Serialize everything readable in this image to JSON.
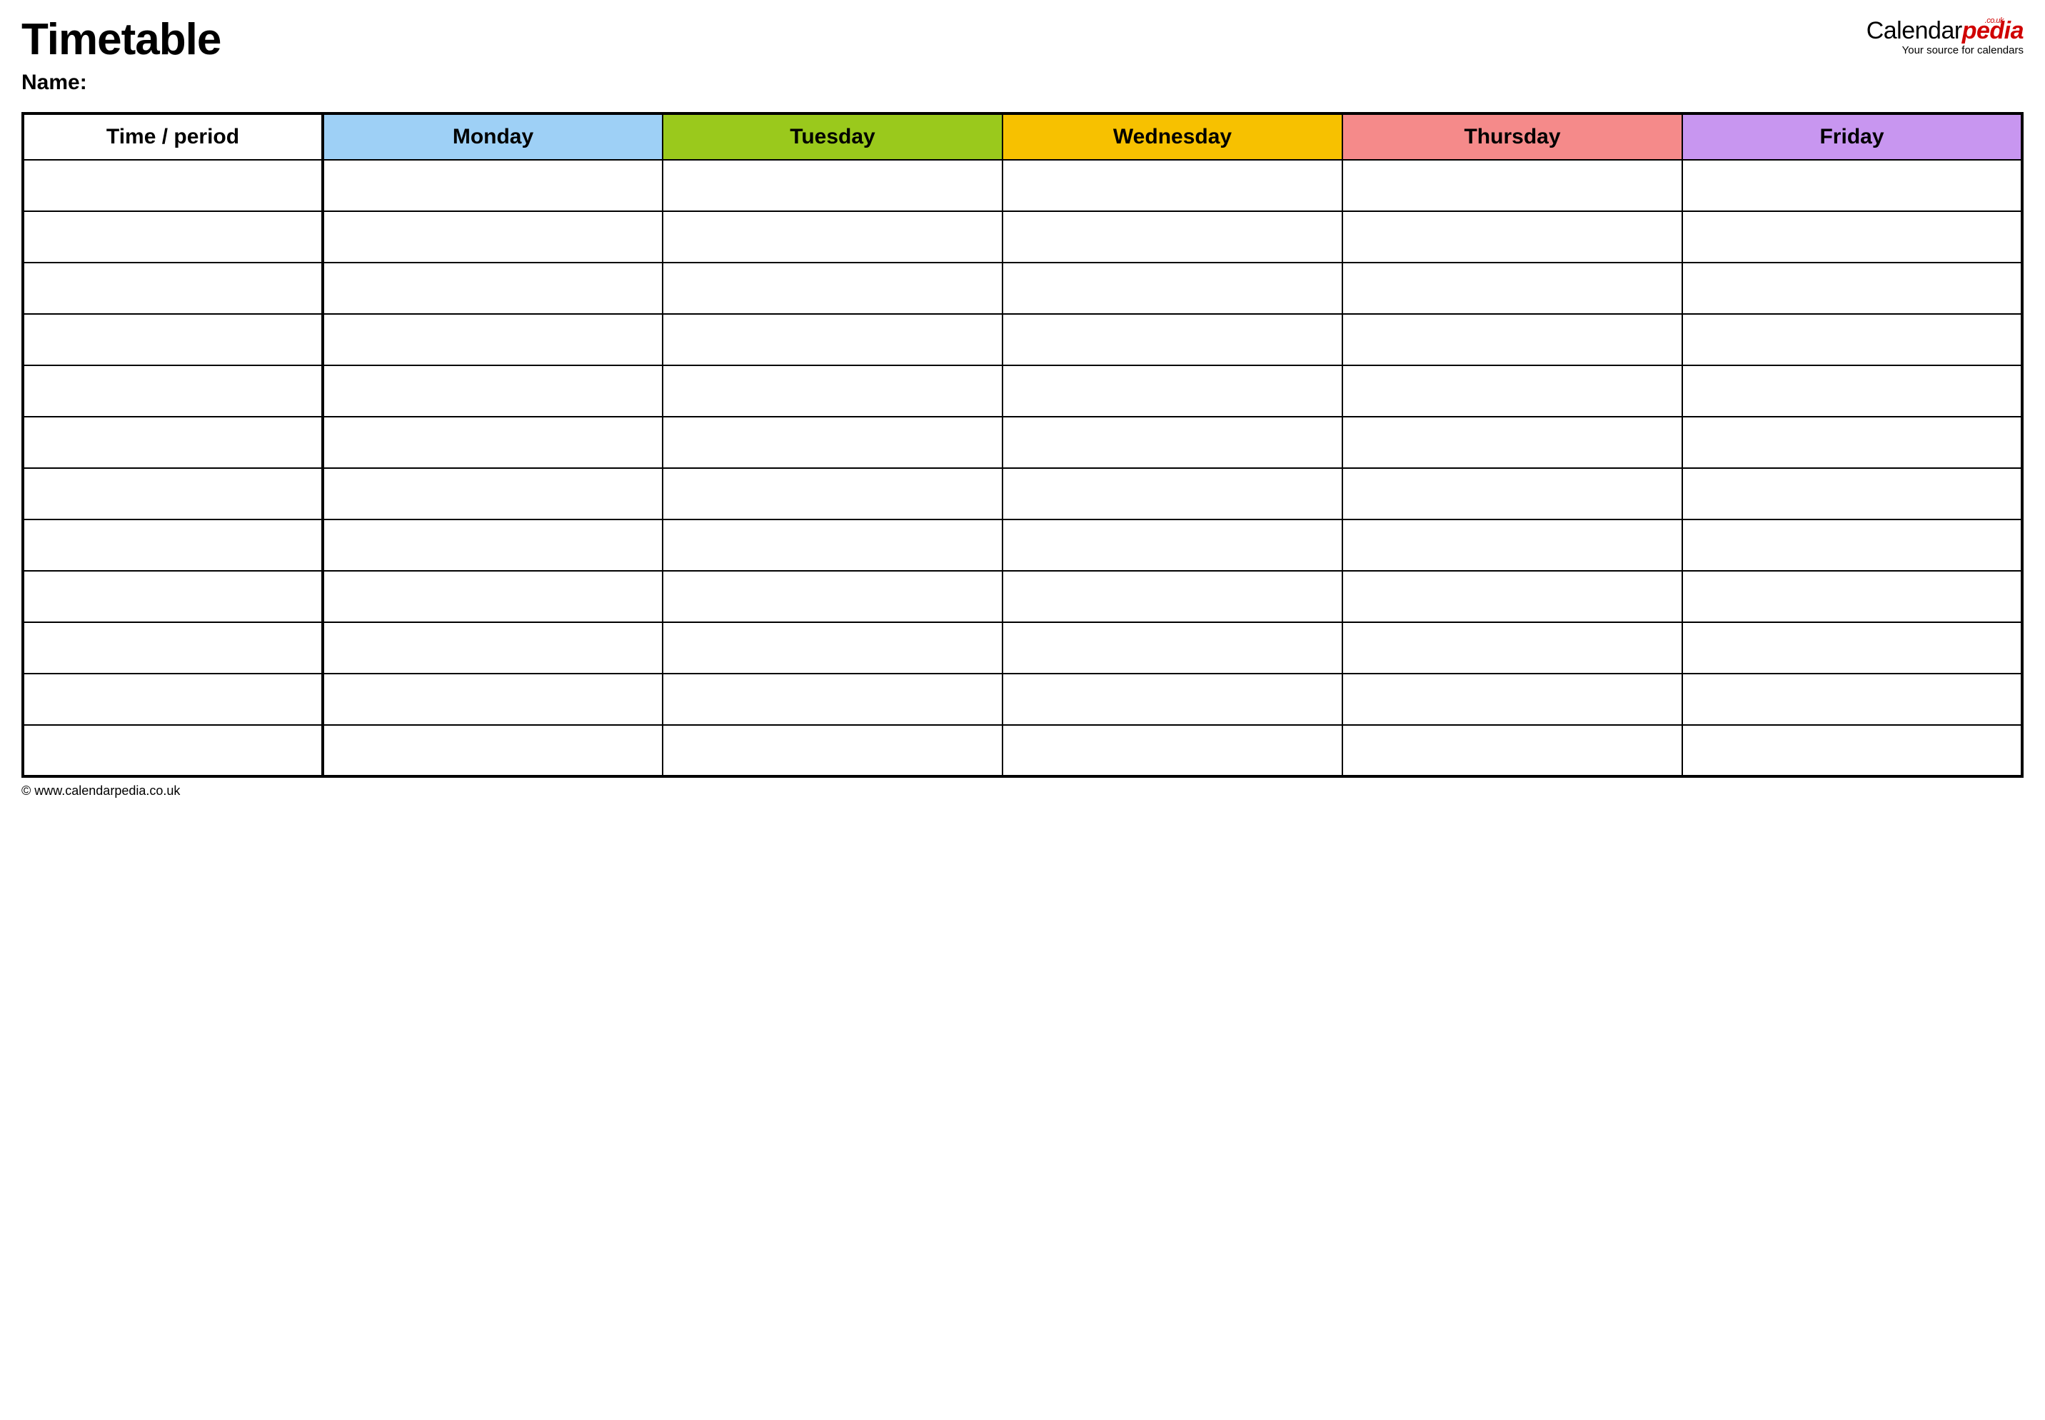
{
  "header": {
    "title": "Timetable",
    "name_label": "Name:"
  },
  "logo": {
    "brand_prefix": "Calendar",
    "brand_suffix": "pedia",
    "tld": ".co.uk",
    "tagline": "Your source for calendars"
  },
  "table": {
    "period_header": "Time / period",
    "days": [
      {
        "label": "Monday",
        "color": "#9ed0f6"
      },
      {
        "label": "Tuesday",
        "color": "#9ac91c"
      },
      {
        "label": "Wednesday",
        "color": "#f7c100"
      },
      {
        "label": "Thursday",
        "color": "#f58a8a"
      },
      {
        "label": "Friday",
        "color": "#c896f0"
      }
    ],
    "row_count": 12
  },
  "footer": {
    "copyright": "© www.calendarpedia.co.uk"
  }
}
